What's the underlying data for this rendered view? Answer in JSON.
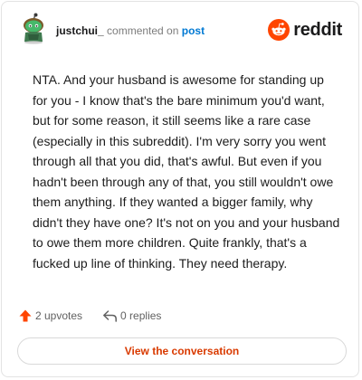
{
  "comment": {
    "username": "justchui_",
    "action": "commented on",
    "target": "post",
    "body": "NTA. And your husband is awesome for standing up for you - I know that's the bare minimum you'd want, but for some reason, it still seems like a rare case (especially in this subreddit). I'm very sorry you went through all that you did, that's awful. But even if you hadn't been through any of that, you still wouldn't owe them anything. If they wanted a bigger family, why didn't they have one? It's not on you and your husband to owe them more children. Quite frankly, that's a fucked up line of thinking. They need therapy."
  },
  "brand": {
    "name": "reddit",
    "color": "#ff4500"
  },
  "stats": {
    "upvotes": "2 upvotes",
    "replies": "0 replies"
  },
  "cta": {
    "label": "View the conversation",
    "color": "#d93a00"
  },
  "icons": {
    "avatar": "avatar-snoo-icon",
    "logo": "reddit-logo-icon",
    "upvote": "upvote-arrow-icon",
    "reply": "reply-arrow-icon"
  }
}
